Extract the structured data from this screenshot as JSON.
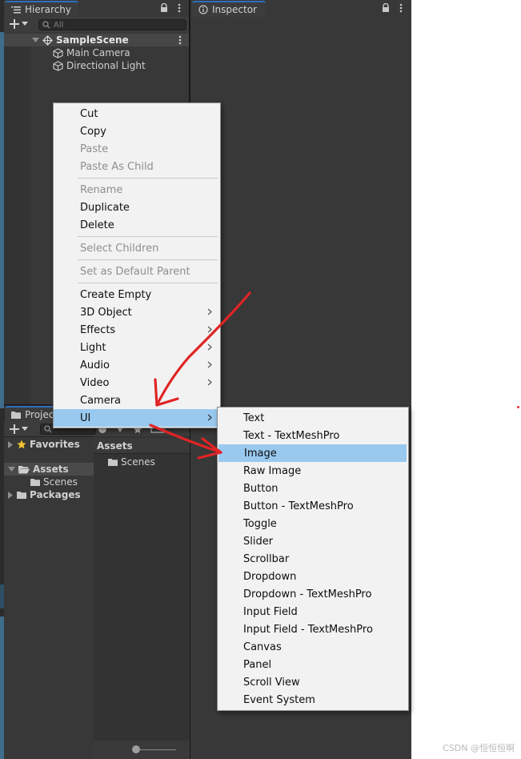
{
  "hierarchy": {
    "tab_label": "Hierarchy",
    "search_placeholder": "All",
    "scene_name": "SampleScene",
    "objects": [
      "Main Camera",
      "Directional Light"
    ]
  },
  "inspector": {
    "tab_label": "Inspector"
  },
  "project": {
    "tab_label": "Project",
    "favorites_label": "Favorites",
    "assets_label": "Assets",
    "scenes_label": "Scenes",
    "packages_label": "Packages",
    "breadcrumb": "Assets",
    "folder_scenes": "Scenes"
  },
  "context_menu": {
    "items": [
      {
        "label": "Cut",
        "enabled": true
      },
      {
        "label": "Copy",
        "enabled": true
      },
      {
        "label": "Paste",
        "enabled": false
      },
      {
        "label": "Paste As Child",
        "enabled": false
      },
      {
        "label": "Rename",
        "enabled": false
      },
      {
        "label": "Duplicate",
        "enabled": true
      },
      {
        "label": "Delete",
        "enabled": true
      },
      {
        "label": "Select Children",
        "enabled": false
      },
      {
        "label": "Set as Default Parent",
        "enabled": false
      },
      {
        "label": "Create Empty",
        "enabled": true
      },
      {
        "label": "3D Object",
        "enabled": true,
        "submenu": true
      },
      {
        "label": "Effects",
        "enabled": true,
        "submenu": true
      },
      {
        "label": "Light",
        "enabled": true,
        "submenu": true
      },
      {
        "label": "Audio",
        "enabled": true,
        "submenu": true
      },
      {
        "label": "Video",
        "enabled": true,
        "submenu": true
      },
      {
        "label": "Camera",
        "enabled": true
      },
      {
        "label": "UI",
        "enabled": true,
        "submenu": true,
        "highlighted": true
      }
    ]
  },
  "ui_submenu": {
    "items": [
      {
        "label": "Text"
      },
      {
        "label": "Text - TextMeshPro"
      },
      {
        "label": "Image",
        "highlighted": true
      },
      {
        "label": "Raw Image"
      },
      {
        "label": "Button"
      },
      {
        "label": "Button - TextMeshPro"
      },
      {
        "label": "Toggle"
      },
      {
        "label": "Slider"
      },
      {
        "label": "Scrollbar"
      },
      {
        "label": "Dropdown"
      },
      {
        "label": "Dropdown - TextMeshPro"
      },
      {
        "label": "Input Field"
      },
      {
        "label": "Input Field - TextMeshPro"
      },
      {
        "label": "Canvas"
      },
      {
        "label": "Panel"
      },
      {
        "label": "Scroll View"
      },
      {
        "label": "Event System"
      }
    ]
  },
  "colors": {
    "menu_bg": "#f2f2f2",
    "menu_highlight": "#99c9ef",
    "annotation_red": "#e02424",
    "editor_panel": "#383838"
  },
  "watermark": "CSDN @恒恒恒啊"
}
